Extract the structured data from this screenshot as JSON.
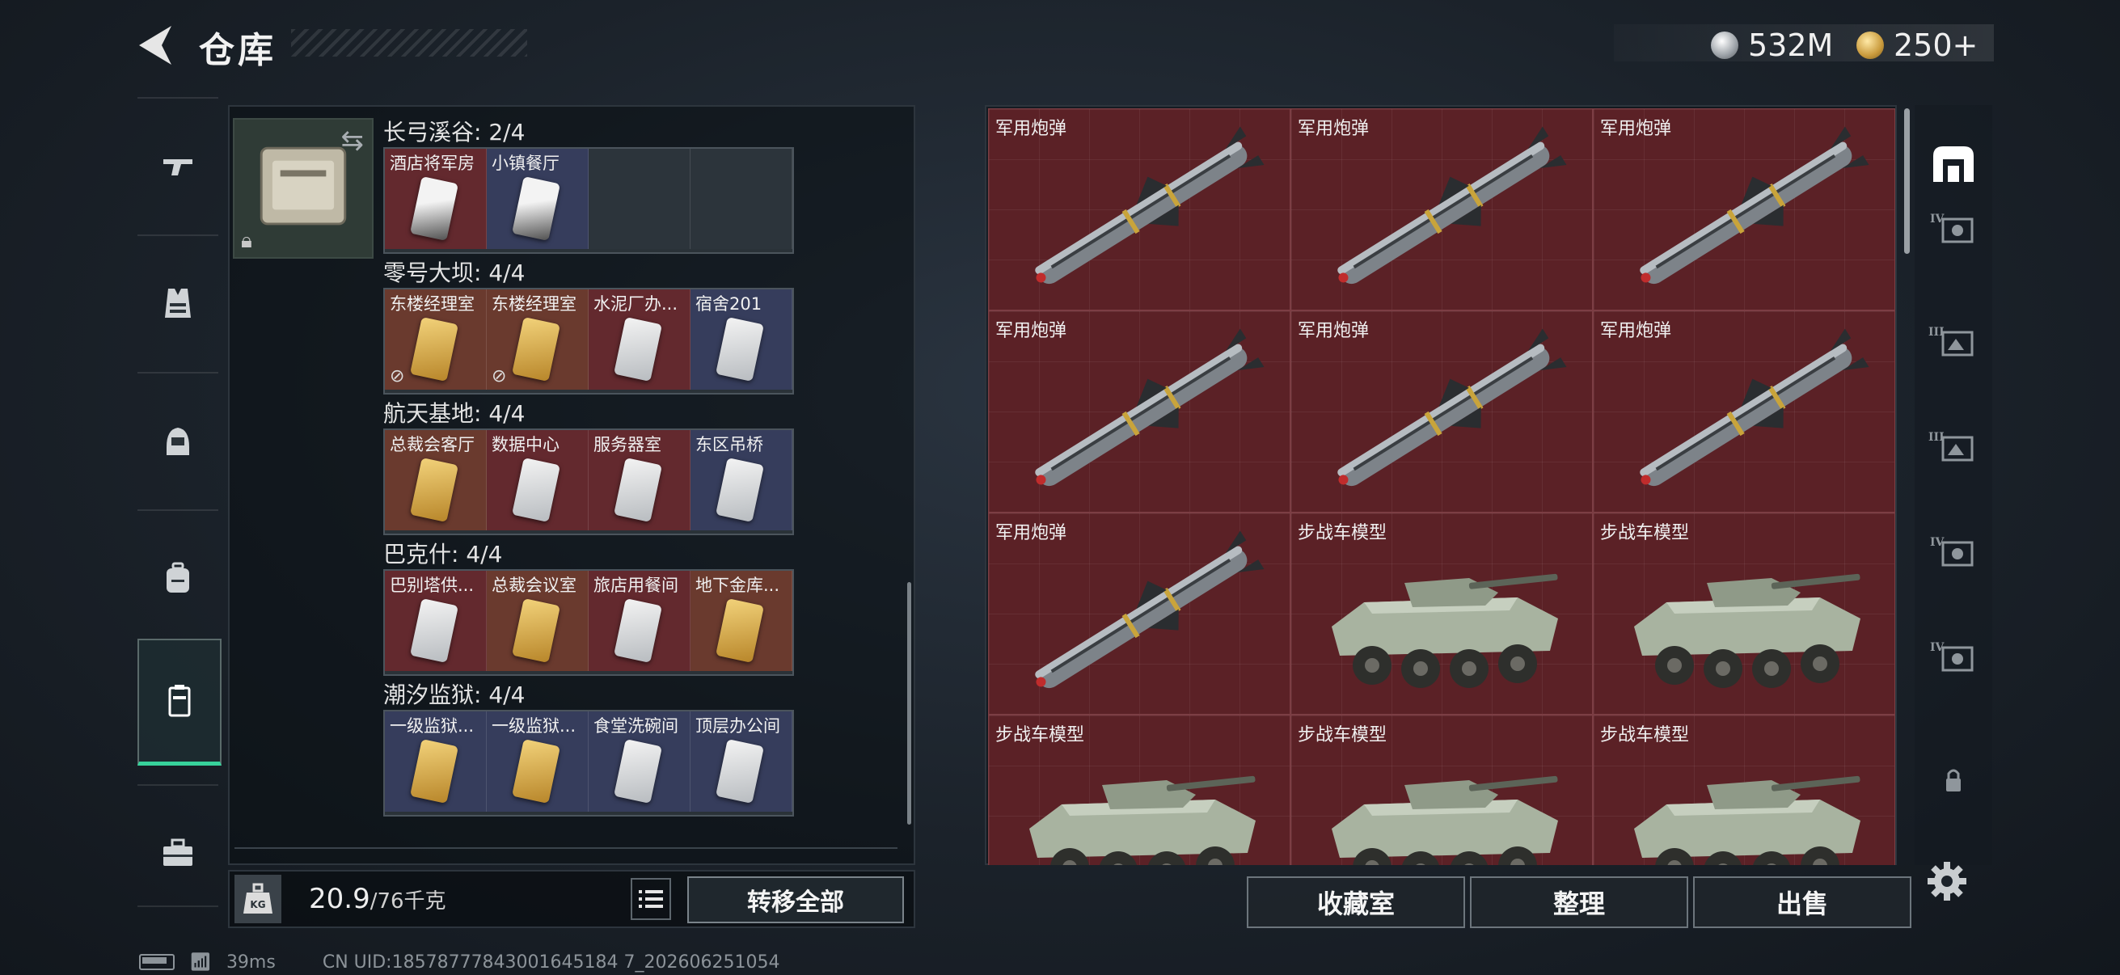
{
  "header": {
    "title": "仓库"
  },
  "currency": [
    {
      "name": "silver-coin-icon",
      "value": "532M",
      "color": "#c9ccd0"
    },
    {
      "name": "gold-coin-icon",
      "value": "250+",
      "color": "#d9b25a"
    }
  ],
  "nav": {
    "items": [
      {
        "id": "weapons",
        "icon": "gun-icon"
      },
      {
        "id": "armor",
        "icon": "vest-icon"
      },
      {
        "id": "helmet",
        "icon": "helmet-icon"
      },
      {
        "id": "backpack",
        "icon": "backpack-icon"
      },
      {
        "id": "keycards",
        "icon": "keycard-case-icon",
        "active": true
      },
      {
        "id": "toolbox",
        "icon": "toolbox-icon"
      }
    ],
    "active_color": "#37d29b"
  },
  "keycard_case": {
    "locations": [
      {
        "name": "长弓溪谷: 2/4",
        "cards": [
          {
            "label": "酒店将军房",
            "style": "red",
            "kc": "kc-black",
            "nocopy": false
          },
          {
            "label": "小镇餐厅",
            "style": "purple",
            "kc": "kc-black",
            "nocopy": false
          },
          {
            "label": "",
            "style": "empty"
          },
          {
            "label": "",
            "style": "empty"
          }
        ]
      },
      {
        "name": "零号大坝: 4/4",
        "cards": [
          {
            "label": "东楼经理室",
            "style": "gold",
            "kc": "kc-gold",
            "nocopy": true
          },
          {
            "label": "东楼经理室",
            "style": "gold",
            "kc": "kc-gold",
            "nocopy": true
          },
          {
            "label": "水泥厂办...",
            "style": "red",
            "kc": "kc-white",
            "nocopy": false
          },
          {
            "label": "宿舍201",
            "style": "purple",
            "kc": "kc-white",
            "nocopy": false
          }
        ]
      },
      {
        "name": "航天基地: 4/4",
        "cards": [
          {
            "label": "总裁会客厅",
            "style": "gold",
            "kc": "kc-gold",
            "nocopy": false
          },
          {
            "label": "数据中心",
            "style": "red",
            "kc": "kc-white",
            "nocopy": false
          },
          {
            "label": "服务器室",
            "style": "red",
            "kc": "kc-white",
            "nocopy": false
          },
          {
            "label": "东区吊桥",
            "style": "purple",
            "kc": "kc-white",
            "nocopy": false
          }
        ]
      },
      {
        "name": "巴克什: 4/4",
        "cards": [
          {
            "label": "巴别塔供...",
            "style": "red",
            "kc": "kc-white",
            "nocopy": false
          },
          {
            "label": "总裁会议室",
            "style": "gold",
            "kc": "kc-gold",
            "nocopy": false
          },
          {
            "label": "旅店用餐间",
            "style": "red",
            "kc": "kc-white",
            "nocopy": false
          },
          {
            "label": "地下金库...",
            "style": "gold",
            "kc": "kc-gold",
            "nocopy": false
          }
        ]
      },
      {
        "name": "潮汐监狱: 4/4",
        "cards": [
          {
            "label": "一级监狱...",
            "style": "purple",
            "kc": "kc-gold",
            "nocopy": false
          },
          {
            "label": "一级监狱...",
            "style": "purple",
            "kc": "kc-gold",
            "nocopy": false
          },
          {
            "label": "食堂洗碗间",
            "style": "purple",
            "kc": "kc-white",
            "nocopy": false
          },
          {
            "label": "顶层办公间",
            "style": "purple",
            "kc": "kc-white",
            "nocopy": false
          }
        ]
      }
    ]
  },
  "weight": {
    "current": "20.9",
    "max": "/76千克",
    "icon": "kg-icon"
  },
  "actions": {
    "transfer_all": "转移全部",
    "collection": "收藏室",
    "organize": "整理",
    "sell": "出售"
  },
  "grid": {
    "items": [
      {
        "label": "军用炮弹",
        "type": "missile"
      },
      {
        "label": "军用炮弹",
        "type": "missile"
      },
      {
        "label": "军用炮弹",
        "type": "missile"
      },
      {
        "label": "军用炮弹",
        "type": "missile"
      },
      {
        "label": "军用炮弹",
        "type": "missile"
      },
      {
        "label": "军用炮弹",
        "type": "missile"
      },
      {
        "label": "军用炮弹",
        "type": "missile"
      },
      {
        "label": "步战车模型",
        "type": "ifv"
      },
      {
        "label": "步战车模型",
        "type": "ifv"
      },
      {
        "label": "步战车模型",
        "type": "ifv"
      },
      {
        "label": "步战车模型",
        "type": "ifv"
      },
      {
        "label": "步战车模型",
        "type": "ifv"
      }
    ]
  },
  "filters": [
    {
      "id": "all",
      "icon": "warehouse-icon",
      "active": true
    },
    {
      "id": "tier4-a",
      "icon": "tier-iv-item-icon",
      "tier": "IV"
    },
    {
      "id": "tier3-a",
      "icon": "tier-iii-item-icon",
      "tier": "III"
    },
    {
      "id": "tier3-b",
      "icon": "tier-iii-item-icon",
      "tier": "III"
    },
    {
      "id": "tier4-b",
      "icon": "tier-iv-item-icon",
      "tier": "IV"
    },
    {
      "id": "tier4-c",
      "icon": "tier-iv-item-icon",
      "tier": "IV"
    },
    {
      "id": "locked",
      "icon": "lock-icon"
    }
  ],
  "status": {
    "ping": "39ms",
    "uid": "CN UID:18578777843001645184 7_202606251054"
  }
}
